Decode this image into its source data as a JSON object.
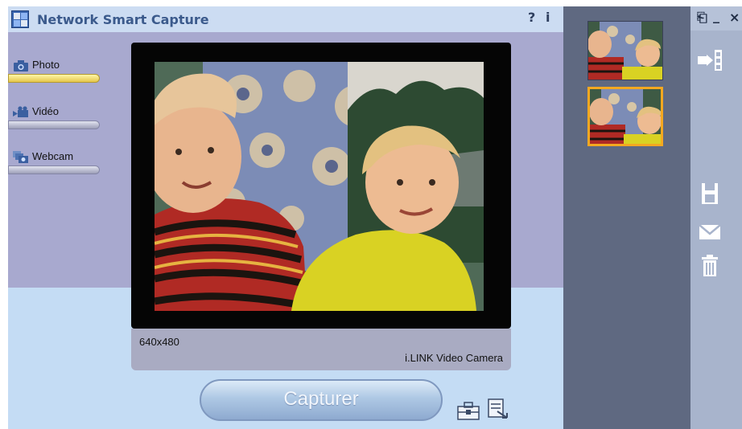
{
  "app": {
    "title": "Network Smart Capture",
    "help": "?",
    "info": "i"
  },
  "window_controls": {
    "restore": "⎗",
    "minimize": "_",
    "close": "×"
  },
  "modes": [
    {
      "label": "Photo",
      "icon": "camera-icon",
      "active": true
    },
    {
      "label": "Vidéo",
      "icon": "video-camera-icon",
      "active": false
    },
    {
      "label": "Webcam",
      "icon": "webcam-icon",
      "active": false
    }
  ],
  "preview": {
    "resolution": "640x480",
    "camera": "i.LINK Video Camera"
  },
  "capture_button": {
    "label": "Capturer"
  },
  "thumbnails": [
    {
      "selected": false
    },
    {
      "selected": true
    }
  ],
  "toolbar": {
    "icons": [
      "import-icon",
      "save-icon",
      "email-icon",
      "trash-icon"
    ]
  },
  "colors": {
    "accent_selected": "#f4a820",
    "title_text": "#3b5a8c",
    "panel": "#c4dcf4"
  }
}
